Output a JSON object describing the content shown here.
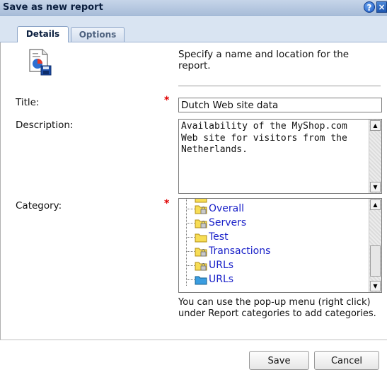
{
  "window": {
    "title": "Save as new report"
  },
  "tabs": [
    {
      "label": "Details",
      "active": true
    },
    {
      "label": "Options",
      "active": false
    }
  ],
  "intro_text": "Specify a name and location for the report.",
  "form": {
    "title_label": "Title:",
    "title_value": "Dutch Web site data",
    "description_label": "Description:",
    "description_value": "Availability of the MyShop.com Web site for visitors from the Netherlands.",
    "category_label": "Category:",
    "required_mark": "*"
  },
  "category_tree": [
    {
      "label": "Overall",
      "icon": "folder-locked-icon"
    },
    {
      "label": "Servers",
      "icon": "folder-locked-icon"
    },
    {
      "label": "Test",
      "icon": "folder-icon"
    },
    {
      "label": "Transactions",
      "icon": "folder-locked-icon"
    },
    {
      "label": "URLs",
      "icon": "folder-locked-icon"
    },
    {
      "label": "URLs",
      "icon": "folder-selected-icon"
    }
  ],
  "hint_text": "You can use the pop-up menu (right click) under Report categories to add categories.",
  "buttons": {
    "save": "Save",
    "cancel": "Cancel"
  },
  "colors": {
    "titlebar": "#b8cae3",
    "required": "#e00000",
    "tree_link": "#1b22c9",
    "folder": "#f7dd55",
    "folder_selected": "#3a9de0"
  }
}
